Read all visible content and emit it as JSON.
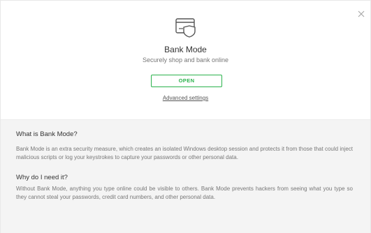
{
  "dialog": {
    "title": "Bank Mode",
    "subtitle": "Securely shop and bank online",
    "open_button_label": "OPEN",
    "advanced_link_label": "Advanced settings",
    "close_icon": "close-icon",
    "mode_icon": "card-shield-icon"
  },
  "info": {
    "q1": "What is Bank Mode?",
    "a1": "Bank Mode is an extra security measure, which creates an isolated Windows desktop session and protects it from those that could inject malicious scripts or log your keystrokes to capture your passwords or other personal data.",
    "q2": "Why do I need it?",
    "a2": "Without Bank Mode, anything you type online could be visible to others. Bank Mode prevents hackers from seeing what you type so they cannot steal your passwords, credit card numbers, and other personal data."
  },
  "colors": {
    "accent": "#2ab24b",
    "panel_bg": "#f4f4f4"
  }
}
